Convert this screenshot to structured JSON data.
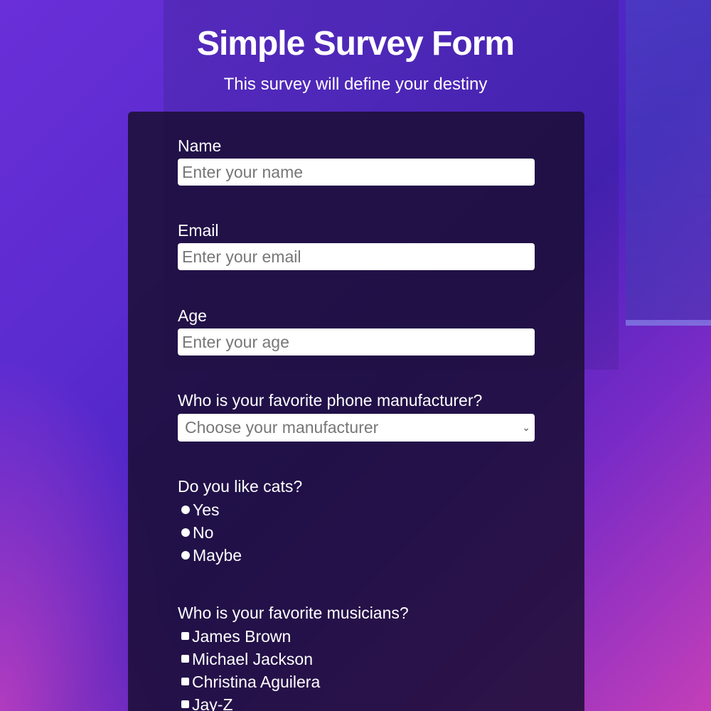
{
  "header": {
    "title": "Simple Survey Form",
    "subtitle": "This survey will define your destiny"
  },
  "form": {
    "name": {
      "label": "Name",
      "placeholder": "Enter your name",
      "value": ""
    },
    "email": {
      "label": "Email",
      "placeholder": "Enter your email",
      "value": ""
    },
    "age": {
      "label": "Age",
      "placeholder": "Enter your age",
      "value": ""
    },
    "manufacturer": {
      "label": "Who is your favorite phone manufacturer?",
      "selected": "Choose your manufacturer"
    },
    "cats": {
      "label": "Do you like cats?",
      "options": [
        "Yes",
        "No",
        "Maybe"
      ]
    },
    "musicians": {
      "label": "Who is your favorite musicians?",
      "options": [
        "James Brown",
        "Michael Jackson",
        "Christina Aguilera",
        "Jay-Z"
      ]
    }
  },
  "icons": {
    "select_arrow": "chevron-down-icon",
    "radio": "radio-button-icon",
    "checkbox": "checkbox-icon"
  },
  "colors": {
    "card_background": "#1b0e34",
    "input_background": "#ffffff",
    "text": "#ffffff",
    "placeholder": "#777777"
  }
}
